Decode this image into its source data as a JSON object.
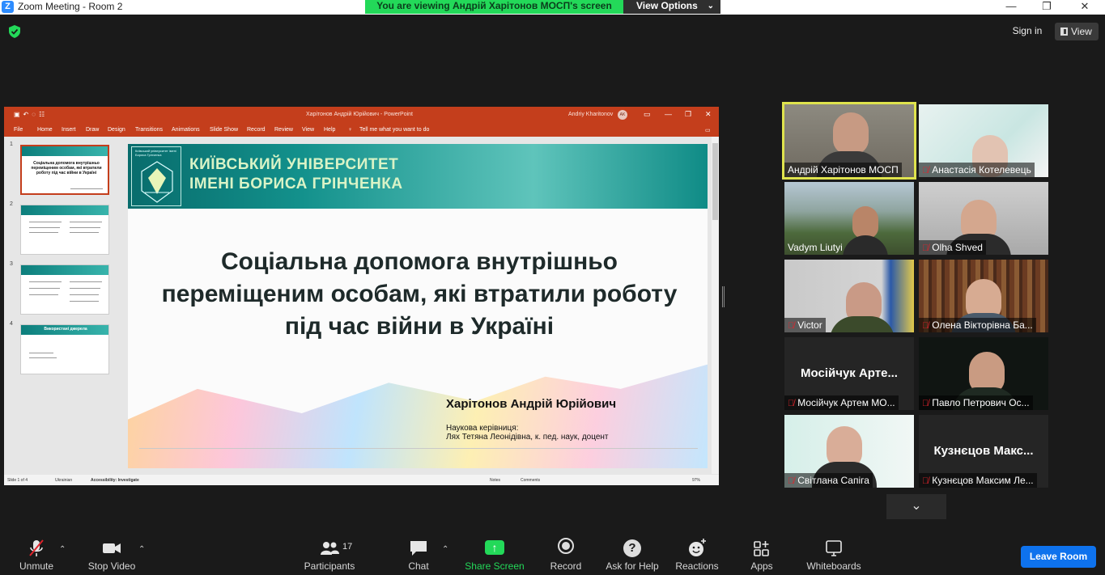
{
  "window": {
    "title": "Zoom Meeting - Room 2",
    "minimize": "—",
    "maximize": "❐",
    "close": "✕"
  },
  "share_banner": {
    "text": "You are viewing Андрій Харітонов МОСП's screen",
    "view_options": "View Options"
  },
  "top_right": {
    "sign_in": "Sign in",
    "view": "View"
  },
  "powerpoint": {
    "title": "Харітонов Андрій Юрійович  -  PowerPoint",
    "user": "Andriy Kharitonov",
    "user_initials": "AK",
    "menu": [
      "File",
      "Home",
      "Insert",
      "Draw",
      "Design",
      "Transitions",
      "Animations",
      "Slide Show",
      "Record",
      "Review",
      "View",
      "Help"
    ],
    "tell_me": "Tell me what you want to do",
    "thumbs": [
      {
        "num": "1",
        "title": "Соціальна допомога внутрішньо переміщеним особам, які втратили роботу під час війни в Україні"
      },
      {
        "num": "2",
        "title": ""
      },
      {
        "num": "3",
        "title": ""
      },
      {
        "num": "4",
        "title": "Використані джерела"
      }
    ],
    "slide": {
      "logo_text": "Київський університет імені Бориса Грінченка",
      "university_line1": "КИЇВСЬКИЙ УНІВЕРСИТЕТ",
      "university_line2": "ІМЕНІ БОРИСА ГРІНЧЕНКА",
      "title": "Соціальна допомога внутрішньо переміщеним особам, які втратили роботу під час війни в Україні",
      "author": "Харітонов Андрій Юрійович",
      "supervisor_label": "Наукова керівниця:",
      "supervisor": "Лях Тетяна Леонідівна, к. пед. наук, доцент"
    },
    "status": {
      "slide": "Slide 1 of 4",
      "lang": "Ukrainian",
      "accessibility": "Accessibility: Investigate",
      "notes": "Notes",
      "comments": "Comments",
      "zoom": "97%"
    }
  },
  "participants": [
    {
      "name": "Андрій Харітонов МОСП",
      "muted": false,
      "active": true
    },
    {
      "name": "Анастасія Котелевець",
      "muted": true
    },
    {
      "name": "Vadym Liutyi",
      "muted": false
    },
    {
      "name": "Olha Shved",
      "muted": true
    },
    {
      "name": "Victor",
      "muted": true
    },
    {
      "name": "Олена Вікторівна Ба...",
      "muted": true
    },
    {
      "name": "Мосійчук Артем МО...",
      "muted": true,
      "big": "Мосійчук Арте..."
    },
    {
      "name": "Павло Петрович Ос...",
      "muted": true
    },
    {
      "name": "Світлана Сапіга",
      "muted": true
    },
    {
      "name": "Кузнєцов Максим Ле...",
      "muted": true,
      "big": "Кузнєцов Макс..."
    }
  ],
  "toolbar": {
    "unmute": "Unmute",
    "stop_video": "Stop Video",
    "participants": "Participants",
    "participants_count": "17",
    "chat": "Chat",
    "share_screen": "Share Screen",
    "record": "Record",
    "ask_for_help": "Ask for Help",
    "reactions": "Reactions",
    "apps": "Apps",
    "whiteboards": "Whiteboards",
    "leave": "Leave Room"
  }
}
